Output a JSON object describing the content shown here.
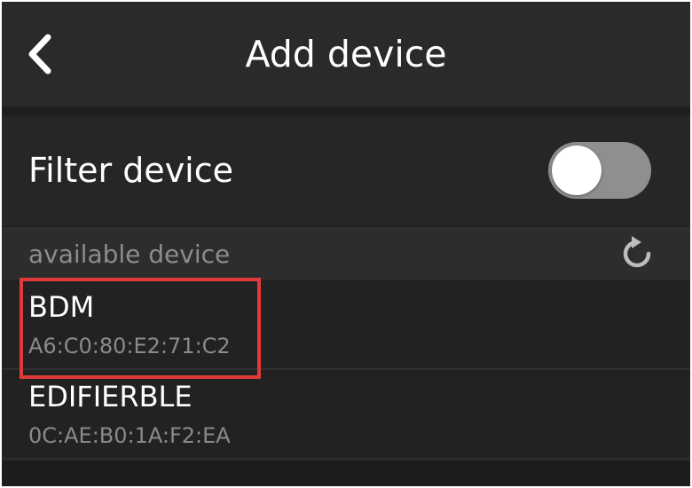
{
  "header": {
    "title": "Add device",
    "back_icon": "chevron-left-icon"
  },
  "filter": {
    "label": "Filter device",
    "enabled": false
  },
  "available": {
    "label": "available device",
    "refresh_icon": "refresh-icon"
  },
  "devices": [
    {
      "name": "BDM",
      "mac": "A6:C0:80:E2:71:C2",
      "highlighted": true
    },
    {
      "name": "EDIFIERBLE",
      "mac": "0C:AE:B0:1A:F2:EA",
      "highlighted": false
    }
  ],
  "colors": {
    "background": "#222222",
    "highlight": "#e03a3a",
    "toggle_track": "#8f8f8f"
  }
}
